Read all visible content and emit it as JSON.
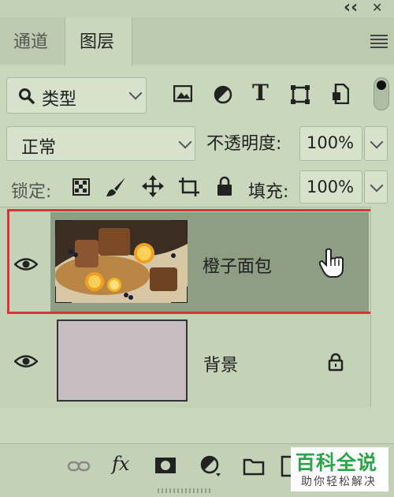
{
  "topbar": {
    "collapse_glyph": "‹‹",
    "close_glyph": "✕"
  },
  "tabs": [
    {
      "label": "通道"
    },
    {
      "label": "图层"
    }
  ],
  "filter": {
    "label": "类型"
  },
  "blend": {
    "mode": "正常",
    "opacity_label": "不透明度:",
    "opacity_value": "100%"
  },
  "lock": {
    "label": "锁定:",
    "fill_label": "填充:",
    "fill_value": "100%"
  },
  "layers": [
    {
      "name": "橙子面包",
      "selected": true
    },
    {
      "name": "背景",
      "locked": true,
      "swatch_color": "#c7bcc0"
    }
  ],
  "footer": {
    "fx_label": "fx"
  },
  "watermark": {
    "title": "百科全说",
    "subtitle": "助你轻松解决"
  },
  "colors": {
    "panel": "#c9d7bd",
    "selected_row": "#8e9e85",
    "highlight_border": "#d4363c",
    "watermark_text": "#2aa54a"
  }
}
